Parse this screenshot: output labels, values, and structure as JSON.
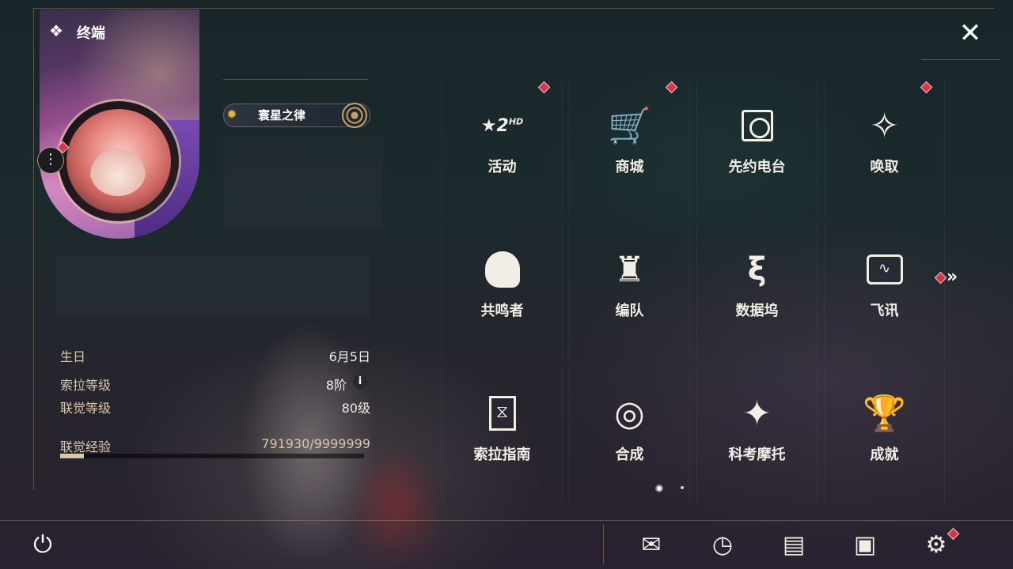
{
  "terminal": {
    "title": "终端"
  },
  "profile": {
    "tag_label": "寰星之律",
    "info": [
      {
        "label": "生日",
        "value": "6月5日"
      },
      {
        "label": "索拉等级",
        "value": "8阶"
      },
      {
        "label": "联觉等级",
        "value": "80级"
      }
    ],
    "exp_label": "联觉经验",
    "exp_value": "791930/9999999",
    "exp_fraction": 0.079
  },
  "grid": [
    {
      "label": "活动",
      "icon": "event-2hd-icon",
      "badge": true
    },
    {
      "label": "商城",
      "icon": "shop-cart-icon",
      "badge": true
    },
    {
      "label": "先约电台",
      "icon": "radio-icon",
      "badge": false
    },
    {
      "label": "唤取",
      "icon": "summon-compass-icon",
      "badge": true
    },
    {
      "label": "共鸣者",
      "icon": "resonator-icon",
      "badge": false
    },
    {
      "label": "编队",
      "icon": "team-chess-icon",
      "badge": false
    },
    {
      "label": "数据坞",
      "icon": "data-dock-icon",
      "badge": false
    },
    {
      "label": "飞讯",
      "icon": "message-icon",
      "badge": false
    },
    {
      "label": "索拉指南",
      "icon": "guide-icon",
      "badge": false
    },
    {
      "label": "合成",
      "icon": "synthesis-icon",
      "badge": false
    },
    {
      "label": "科考摩托",
      "icon": "motorcycle-icon",
      "badge": false
    },
    {
      "label": "成就",
      "icon": "achievement-icon",
      "badge": false
    }
  ],
  "pagination": {
    "current": 1,
    "total": 2
  },
  "colors": {
    "badge": "#d6374e",
    "accent": "#d9c7a5"
  }
}
